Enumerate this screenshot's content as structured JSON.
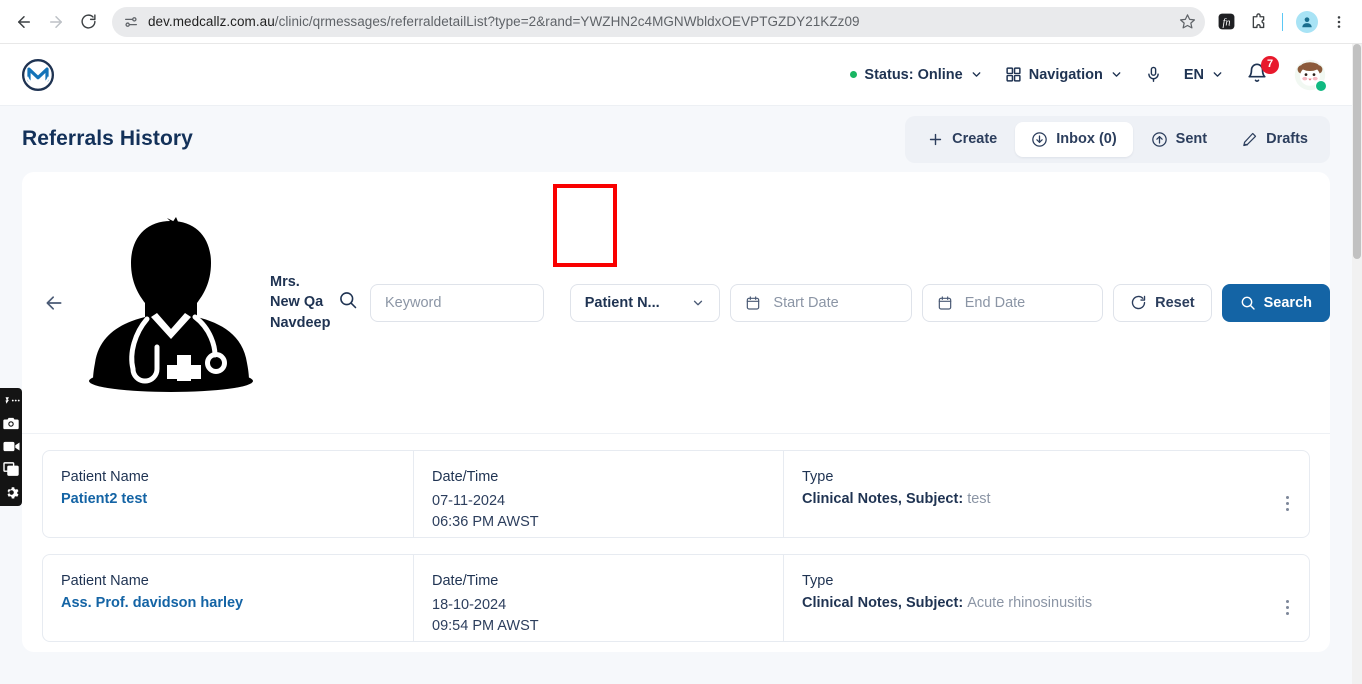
{
  "browser": {
    "back_icon": "back-arrow-icon",
    "forward_icon": "forward-arrow-icon",
    "reload_icon": "reload-icon",
    "site_info_icon": "site-settings-icon",
    "url_host": "dev.medcallz.com.au",
    "url_path": "/clinic/qrmessages/referraldetailList?type=2&rand=YWZHN2c4MGNWbldxOEVPTGZDY21KZz09",
    "bookmark_icon": "star-icon",
    "extension_fn_icon": "fn-extension-icon",
    "extensions_icon": "puzzle-piece-icon",
    "profile_icon": "profile-avatar-icon",
    "menu_icon": "three-dot-menu-icon"
  },
  "app_header": {
    "logo": "medcallz-logo",
    "status": {
      "label": "Status: Online",
      "dot_color": "#19b562",
      "chevron": "chevron-down-icon"
    },
    "navigation": {
      "label": "Navigation",
      "icon": "grid-icon",
      "chevron": "chevron-down-icon"
    },
    "mic_icon": "microphone-icon",
    "language": {
      "label": "EN",
      "chevron": "chevron-down-icon"
    },
    "notifications": {
      "icon": "bell-icon",
      "count": "7",
      "badge_color": "#e8192c"
    },
    "user_avatar": {
      "icon": "panda-avatar",
      "online_color": "#10b981"
    }
  },
  "page": {
    "title": "Referrals History",
    "tabs": [
      {
        "label": "Create",
        "icon": "plus-icon",
        "active": false
      },
      {
        "label": "Inbox (0)",
        "icon": "download-circle-icon",
        "active": true
      },
      {
        "label": "Sent",
        "icon": "upload-circle-icon",
        "active": false
      },
      {
        "label": "Drafts",
        "icon": "pencil-icon",
        "active": false
      }
    ]
  },
  "filters": {
    "back_icon": "back-arrow-icon",
    "doctor_illustration": "doctor-silhouette-icon",
    "doctor_name": "Mrs. New Qa Navdeep",
    "search_glyph": "search-icon",
    "keyword_placeholder": "Keyword",
    "keyword_value": "",
    "search_by": {
      "selected": "Patient N...",
      "chevron": "chevron-down-icon"
    },
    "start_date": {
      "placeholder": "Start Date",
      "value": "",
      "icon": "calendar-icon"
    },
    "end_date": {
      "placeholder": "End Date",
      "value": "",
      "icon": "calendar-icon"
    },
    "reset": {
      "label": "Reset",
      "icon": "refresh-icon"
    },
    "search": {
      "label": "Search",
      "icon": "search-icon",
      "color": "#1464a5"
    },
    "annotation_color": "#f90000"
  },
  "list": {
    "columns": {
      "name": "Patient Name",
      "datetime": "Date/Time",
      "type": "Type"
    },
    "rows": [
      {
        "patient_name": "Patient2 test",
        "date": "07-11-2024",
        "time": "06:36 PM AWST",
        "type_label": "Clinical Notes, Subject:",
        "type_subject": "test",
        "menu_icon": "kebab-menu-icon"
      },
      {
        "patient_name": "Ass. Prof. davidson harley",
        "date": "18-10-2024",
        "time": "09:54 PM AWST",
        "type_label": "Clinical Notes, Subject:",
        "type_subject": "Acute rhinosinusitis",
        "menu_icon": "kebab-menu-icon"
      }
    ]
  },
  "recorder_toolbar": {
    "drag_icon": "drag-handle-icon",
    "camera_icon": "camera-icon",
    "video_icon": "video-camera-icon",
    "window_icon": "window-capture-icon",
    "settings_icon": "gear-icon"
  }
}
